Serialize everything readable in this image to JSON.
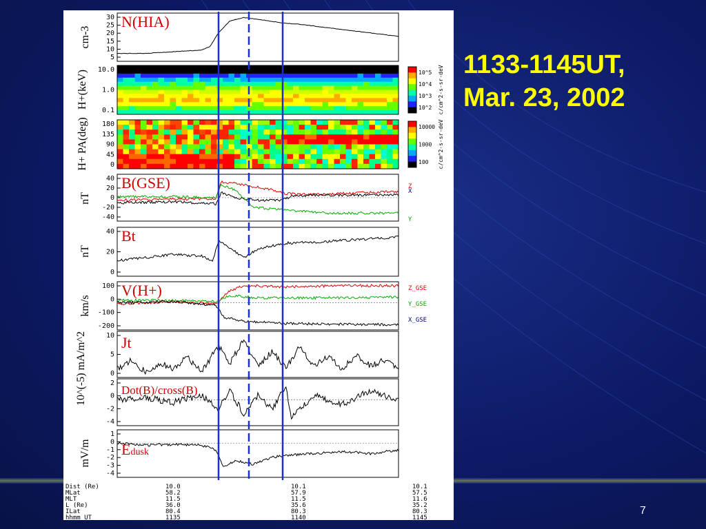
{
  "slide": {
    "title_line1": "1133-1145UT,",
    "title_line2": "Mar. 23, 2002",
    "page_number": "7"
  },
  "chart_data": [
    {
      "id": "nhia",
      "type": "line",
      "title": "N(HIA)",
      "ylabel": "cm-3",
      "yticks": [
        "30",
        "25",
        "20",
        "15",
        "10",
        "5"
      ],
      "ylim": [
        5,
        30
      ],
      "series": [
        {
          "color": "#000000",
          "points": [
            [
              0,
              8
            ],
            [
              0.1,
              8
            ],
            [
              0.2,
              9
            ],
            [
              0.3,
              10
            ],
            [
              0.33,
              12
            ],
            [
              0.36,
              20
            ],
            [
              0.4,
              27
            ],
            [
              0.45,
              29
            ],
            [
              0.5,
              28
            ],
            [
              0.58,
              26
            ],
            [
              0.65,
              25
            ],
            [
              0.75,
              23
            ],
            [
              0.85,
              21
            ],
            [
              0.95,
              19
            ],
            [
              1,
              18
            ]
          ]
        }
      ]
    },
    {
      "id": "hkev",
      "type": "heatmap",
      "ylabel": "H+(keV)",
      "yticks": [
        "10.0",
        "1.0",
        "0.1"
      ],
      "colorbar": {
        "ticks": [
          "10^5",
          "10^4",
          "10^3",
          "10^2"
        ],
        "label": "c/cm^2-s-sr-deV"
      }
    },
    {
      "id": "hpa",
      "type": "heatmap",
      "ylabel": "H+ PA(deg)",
      "yticks": [
        "180",
        "135",
        "90",
        "45",
        "0"
      ],
      "colorbar": {
        "ticks": [
          "10000",
          "1000",
          "100"
        ],
        "label": "c/cm^2-s-sr-deV"
      }
    },
    {
      "id": "bgse",
      "type": "line",
      "title": "B(GSE)",
      "ylabel": "nT",
      "yticks": [
        "40",
        "20",
        "0",
        "-20",
        "-40"
      ],
      "ylim": [
        -40,
        40
      ],
      "legend": [
        {
          "text": "Z",
          "color": "#dd0000"
        },
        {
          "text": "X",
          "color": "#000080"
        },
        {
          "text": "Y",
          "color": "#00aa00"
        }
      ],
      "series": [
        {
          "name": "Z",
          "color": "#dd0000",
          "points": [
            [
              0,
              -5
            ],
            [
              0.2,
              -3
            ],
            [
              0.35,
              -2
            ],
            [
              0.37,
              30
            ],
            [
              0.42,
              28
            ],
            [
              0.5,
              20
            ],
            [
              0.55,
              15
            ],
            [
              0.6,
              8
            ],
            [
              0.7,
              6
            ],
            [
              0.8,
              8
            ],
            [
              0.9,
              10
            ],
            [
              1,
              12
            ]
          ]
        },
        {
          "name": "X",
          "color": "#000000",
          "points": [
            [
              0,
              -10
            ],
            [
              0.2,
              -8
            ],
            [
              0.35,
              -12
            ],
            [
              0.37,
              10
            ],
            [
              0.42,
              0
            ],
            [
              0.5,
              -5
            ],
            [
              0.58,
              -5
            ],
            [
              0.62,
              2
            ],
            [
              0.7,
              5
            ],
            [
              0.85,
              5
            ],
            [
              1,
              6
            ]
          ]
        },
        {
          "name": "Y",
          "color": "#00aa00",
          "points": [
            [
              0,
              2
            ],
            [
              0.2,
              2
            ],
            [
              0.35,
              0
            ],
            [
              0.37,
              25
            ],
            [
              0.42,
              15
            ],
            [
              0.48,
              -18
            ],
            [
              0.55,
              -22
            ],
            [
              0.62,
              -25
            ],
            [
              0.75,
              -30
            ],
            [
              0.9,
              -30
            ],
            [
              1,
              -30
            ]
          ]
        }
      ]
    },
    {
      "id": "bt",
      "type": "line",
      "title": "Bt",
      "ylabel": "nT",
      "yticks": [
        "40",
        "20",
        "0"
      ],
      "ylim": [
        0,
        50
      ],
      "series": [
        {
          "color": "#000000",
          "points": [
            [
              0,
              15
            ],
            [
              0.1,
              18
            ],
            [
              0.2,
              22
            ],
            [
              0.3,
              20
            ],
            [
              0.34,
              15
            ],
            [
              0.36,
              38
            ],
            [
              0.4,
              30
            ],
            [
              0.45,
              18
            ],
            [
              0.5,
              28
            ],
            [
              0.6,
              35
            ],
            [
              0.7,
              36
            ],
            [
              0.8,
              38
            ],
            [
              0.9,
              40
            ],
            [
              1,
              42
            ]
          ]
        }
      ]
    },
    {
      "id": "vh",
      "type": "line",
      "title": "V(H+)",
      "ylabel": "km/s",
      "yticks": [
        "100",
        "0",
        "-100",
        "-200"
      ],
      "ylim": [
        -200,
        150
      ],
      "legend": [
        {
          "text": "Z_GSE",
          "color": "#dd0000"
        },
        {
          "text": "Y_GSE",
          "color": "#00aa00"
        },
        {
          "text": "X_GSE",
          "color": "#000080"
        }
      ],
      "series": [
        {
          "name": "Z_GSE",
          "color": "#dd0000",
          "points": [
            [
              0,
              -10
            ],
            [
              0.2,
              10
            ],
            [
              0.35,
              -10
            ],
            [
              0.4,
              100
            ],
            [
              0.45,
              140
            ],
            [
              0.6,
              130
            ],
            [
              0.8,
              140
            ],
            [
              1,
              140
            ]
          ]
        },
        {
          "name": "Y_GSE",
          "color": "#00aa00",
          "points": [
            [
              0,
              20
            ],
            [
              0.2,
              20
            ],
            [
              0.35,
              10
            ],
            [
              0.4,
              60
            ],
            [
              0.5,
              40
            ],
            [
              0.7,
              40
            ],
            [
              1,
              45
            ]
          ]
        },
        {
          "name": "X_GSE",
          "color": "#000000",
          "points": [
            [
              0,
              0
            ],
            [
              0.2,
              10
            ],
            [
              0.35,
              -20
            ],
            [
              0.38,
              -120
            ],
            [
              0.45,
              -150
            ],
            [
              0.6,
              -170
            ],
            [
              0.8,
              -175
            ],
            [
              1,
              -180
            ]
          ]
        }
      ]
    },
    {
      "id": "jt",
      "type": "line",
      "title": "Jt",
      "ylabel": "10^(-5) mA/m^2",
      "yticks": [
        "10",
        "5",
        "0"
      ],
      "ylim": [
        0,
        14
      ],
      "series": [
        {
          "color": "#000000",
          "points": [
            [
              0,
              2
            ],
            [
              0.05,
              5
            ],
            [
              0.1,
              1
            ],
            [
              0.15,
              4
            ],
            [
              0.2,
              2
            ],
            [
              0.25,
              6
            ],
            [
              0.3,
              1
            ],
            [
              0.36,
              10
            ],
            [
              0.4,
              4
            ],
            [
              0.45,
              12
            ],
            [
              0.5,
              3
            ],
            [
              0.55,
              8
            ],
            [
              0.6,
              2
            ],
            [
              0.65,
              10
            ],
            [
              0.7,
              3
            ],
            [
              0.75,
              6
            ],
            [
              0.8,
              2
            ],
            [
              0.85,
              7
            ],
            [
              0.9,
              3
            ],
            [
              0.95,
              5
            ],
            [
              1,
              2
            ]
          ]
        }
      ]
    },
    {
      "id": "dot",
      "type": "line",
      "title": "Dot(B)/cross(B)",
      "yticks": [
        "2",
        "0",
        "-2",
        "-4"
      ],
      "ylim": [
        -5,
        4
      ],
      "series": [
        {
          "color": "#000000",
          "points": [
            [
              0,
              0
            ],
            [
              0.1,
              0.5
            ],
            [
              0.2,
              -0.5
            ],
            [
              0.3,
              1
            ],
            [
              0.36,
              -2
            ],
            [
              0.4,
              2
            ],
            [
              0.45,
              -3
            ],
            [
              0.5,
              1
            ],
            [
              0.55,
              -2
            ],
            [
              0.6,
              3
            ],
            [
              0.62,
              -4
            ],
            [
              0.7,
              1
            ],
            [
              0.8,
              -1
            ],
            [
              0.9,
              2
            ],
            [
              1,
              0
            ]
          ]
        }
      ]
    },
    {
      "id": "edusk",
      "type": "line",
      "title": "E",
      "title_sub": "dusk",
      "ylabel": "mV/m",
      "yticks": [
        "1",
        "0",
        "-1",
        "-2",
        "-3",
        "-4"
      ],
      "ylim": [
        -4.5,
        1.5
      ],
      "series": [
        {
          "color": "#000000",
          "points": [
            [
              0,
              0
            ],
            [
              0.1,
              -0.3
            ],
            [
              0.2,
              -0.2
            ],
            [
              0.3,
              -0.3
            ],
            [
              0.35,
              -1
            ],
            [
              0.38,
              -3.5
            ],
            [
              0.42,
              -2.5
            ],
            [
              0.48,
              -3
            ],
            [
              0.55,
              -2
            ],
            [
              0.6,
              -1.8
            ],
            [
              0.7,
              -1.5
            ],
            [
              0.8,
              -1.2
            ],
            [
              0.9,
              -1.5
            ],
            [
              1,
              -1
            ]
          ]
        }
      ]
    }
  ],
  "ephemeris": {
    "labels": [
      "Dist (Re)",
      "MLat",
      "MLT",
      "L (Re)",
      "ILat",
      "hhmm UT"
    ],
    "col1": [
      "10.0",
      "58.2",
      "11.5",
      "36.0",
      "80.4",
      "1135"
    ],
    "col2": [
      "10.1",
      "57.9",
      "11.5",
      "35.6",
      "80.3",
      "1140"
    ],
    "col3": [
      "10.1",
      "57.5",
      "11.6",
      "35.2",
      "80.3",
      "1145"
    ]
  }
}
